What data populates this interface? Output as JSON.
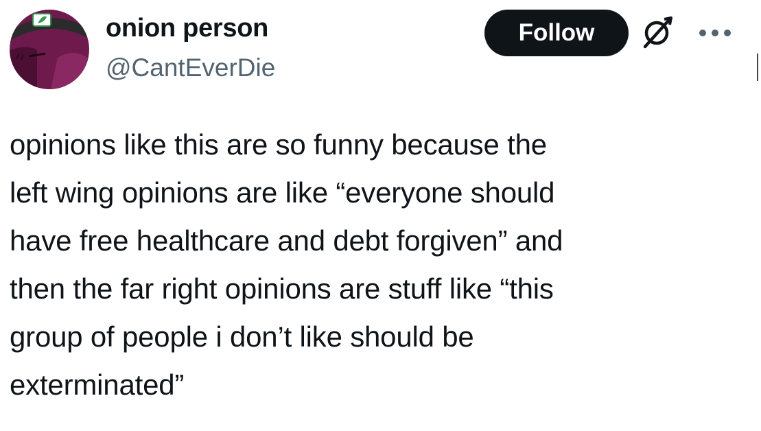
{
  "author": {
    "display_name": "onion person",
    "handle": "@CantEverDie"
  },
  "actions": {
    "follow_label": "Follow",
    "grok_icon": "grok-icon",
    "more_icon": "more-options-icon"
  },
  "tweet": {
    "text": "opinions like this are so funny because the\nleft wing opinions are like “everyone should\nhave free healthcare and debt forgiven” and\nthen the far right opinions are stuff like “this\ngroup of people i don’t like should be\nexterminated”"
  },
  "colors": {
    "follow_bg": "#0f1419",
    "follow_text": "#ffffff",
    "handle_gray": "#536471",
    "avatar_purple": "#7a1e55"
  }
}
